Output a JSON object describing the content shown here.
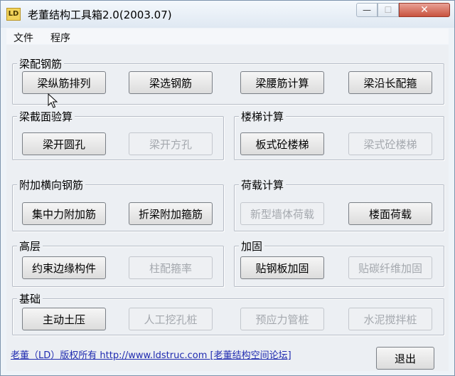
{
  "window": {
    "title": "老董结构工具箱2.0(2003.07)",
    "icon_label": "LD",
    "close_glyph": "✕",
    "min_glyph": "—",
    "max_glyph": "☐"
  },
  "menu": [
    "文件",
    "程序"
  ],
  "groups": {
    "beam_rebar": {
      "title": "梁配钢筋",
      "buttons": [
        "梁纵筋排列",
        "梁选钢筋",
        "梁腰筋计算",
        "梁沿长配箍"
      ]
    },
    "section": {
      "title": "梁截面验算",
      "buttons": [
        "梁开圆孔",
        "梁开方孔"
      ]
    },
    "stair": {
      "title": "楼梯计算",
      "buttons": [
        "板式砼楼梯",
        "梁式砼楼梯"
      ]
    },
    "additional": {
      "title": "附加横向钢筋",
      "buttons": [
        "集中力附加筋",
        "折梁附加箍筋"
      ]
    },
    "load": {
      "title": "荷载计算",
      "buttons": [
        "新型墙体荷载",
        "楼面荷载"
      ]
    },
    "highrise": {
      "title": "高层",
      "buttons": [
        "约束边缘构件",
        "柱配箍率"
      ]
    },
    "reinforce": {
      "title": "加固",
      "buttons": [
        "贴钢板加固",
        "贴碳纤维加固"
      ]
    },
    "foundation": {
      "title": "基础",
      "buttons": [
        "主动土压",
        "人工挖孔桩",
        "预应力管桩",
        "水泥搅拌桩"
      ]
    }
  },
  "footer": {
    "link": "老董（LD）版权所有 http://www.ldstruc.com [老董结构空间论坛]",
    "exit": "退出"
  }
}
